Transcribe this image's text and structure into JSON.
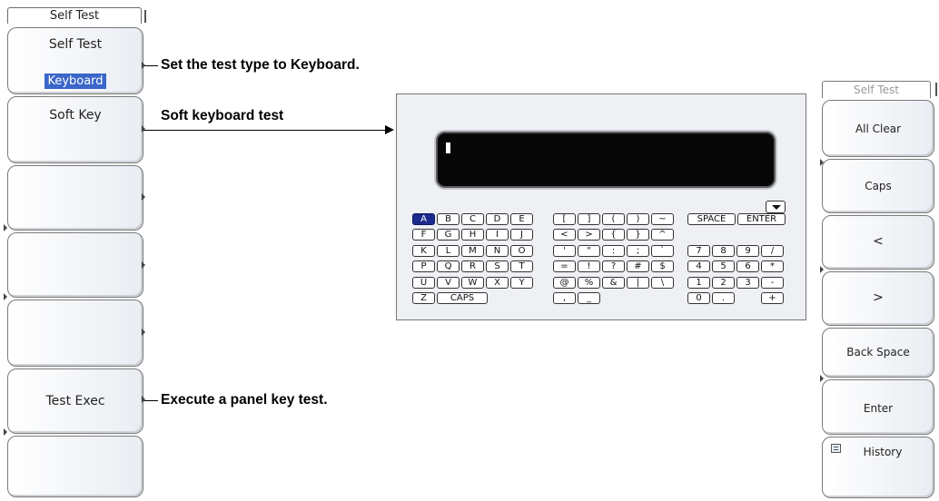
{
  "left_menu": {
    "tab_label": "Self Test",
    "keys": [
      {
        "label": "Self Test",
        "value": "Keyboard"
      },
      {
        "label": "Soft Key"
      },
      {
        "label": ""
      },
      {
        "label": ""
      },
      {
        "label": ""
      },
      {
        "label": "Test Exec"
      },
      {
        "label": ""
      }
    ]
  },
  "callouts": {
    "test_type": "Set the test type to Keyboard.",
    "soft_keyboard": "Soft keyboard test",
    "panel_key": "Execute a panel key test."
  },
  "keyboard": {
    "display_text": "",
    "row1_letters": [
      "A",
      "B",
      "C",
      "D",
      "E"
    ],
    "row2_letters": [
      "F",
      "G",
      "H",
      "I",
      "J"
    ],
    "row3_letters": [
      "K",
      "L",
      "M",
      "N",
      "O"
    ],
    "row4_letters": [
      "P",
      "Q",
      "R",
      "S",
      "T"
    ],
    "row5_letters": [
      "U",
      "V",
      "W",
      "X",
      "Y"
    ],
    "row6_letters": [
      "Z",
      "CAPS"
    ],
    "row1_symbols": [
      "[",
      "]",
      "(",
      ")",
      "~"
    ],
    "row2_symbols": [
      "<",
      ">",
      "{",
      "}",
      "^"
    ],
    "row3_symbols": [
      "'",
      "\"",
      ":",
      ";",
      "`"
    ],
    "row4_symbols": [
      "=",
      "!",
      "?",
      "#",
      "$"
    ],
    "row5_symbols": [
      "@",
      "%",
      "&",
      "|",
      "\\"
    ],
    "row6_symbols": [
      ",",
      "_"
    ],
    "space_label": "SPACE",
    "enter_label": "ENTER",
    "num_row3": [
      "7",
      "8",
      "9",
      "/"
    ],
    "num_row4": [
      "4",
      "5",
      "6",
      "*"
    ],
    "num_row5": [
      "1",
      "2",
      "3",
      "-"
    ],
    "num_row6": [
      "0",
      "."
    ],
    "plus_label": "+",
    "selected_key": "A"
  },
  "right_menu": {
    "tab_label": "Self Test",
    "keys": [
      "All Clear",
      "Caps",
      "<",
      ">",
      "Back Space",
      "Enter",
      "History"
    ],
    "history_icon": "history-icon"
  }
}
